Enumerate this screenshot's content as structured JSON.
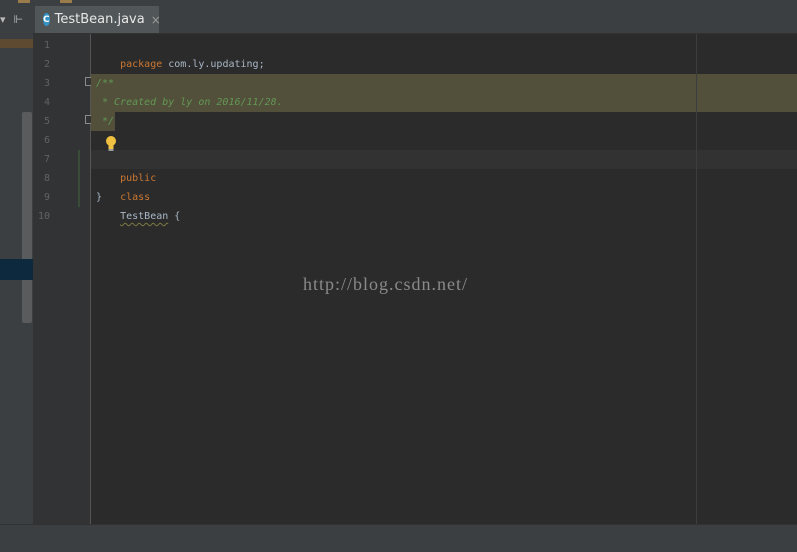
{
  "colors": {
    "editor_bg": "#2b2b2b",
    "keyword": "#cc7832",
    "doc_comment": "#629755",
    "default_text": "#a9b7c6",
    "line_number": "#606366",
    "doc_highlight": "#52503a",
    "tab_active": "#515658"
  },
  "tab": {
    "icon": "class-c-icon",
    "icon_letter": "C",
    "label": "TestBean.java",
    "close": "×"
  },
  "left_tools": {
    "dropdown_glyph": "▾",
    "collapse_glyph": "⊩"
  },
  "line_numbers": [
    "1",
    "2",
    "3",
    "4",
    "5",
    "6",
    "7",
    "8",
    "9",
    "10"
  ],
  "code": {
    "line1_kw": "package",
    "line1_rest": " com.ly.updating;",
    "line3": "/**",
    "line4": " * Created by ly on 2016/11/28.",
    "line5": " */",
    "line7_kw1": "public",
    "line7_kw2": "class",
    "line7_class": "TestBean",
    "line7_brace": " {",
    "line9": "}"
  },
  "watermark": "http://blog.csdn.net/"
}
